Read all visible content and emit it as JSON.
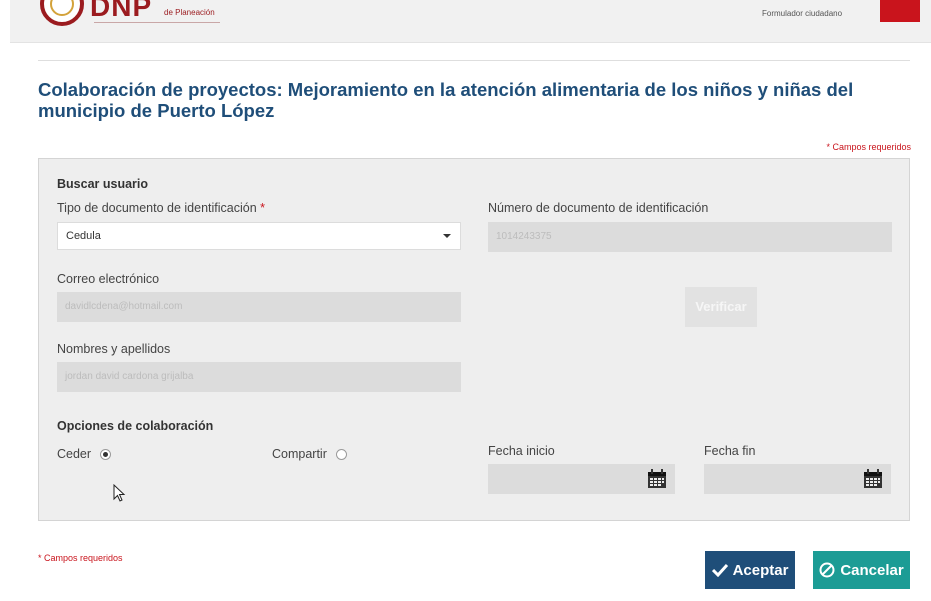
{
  "header": {
    "logo_text": "DNP",
    "logo_subtitle": "de Planeación",
    "user_link": "Formulador ciudadano"
  },
  "page": {
    "title": "Colaboración de proyectos: Mejoramiento en la atención alimentaria de los niños y niñas del municipio de Puerto López",
    "required_note_top": "* Campos requeridos",
    "required_note_bottom": "* Campos requeridos"
  },
  "search": {
    "section_title": "Buscar usuario",
    "doc_type_label": "Tipo de documento de identificación",
    "doc_type_required": "*",
    "doc_type_value": "Cedula",
    "doc_number_label": "Número de documento de identificación",
    "doc_number_value": "1014243375",
    "email_label": "Correo electrónico",
    "email_value": "davidlcdena@hotmail.com",
    "name_label": "Nombres y apellidos",
    "name_value": "jordan david cardona grijalba",
    "verify_label": "Verificar"
  },
  "collab": {
    "section_title": "Opciones de colaboración",
    "option_ceder": "Ceder",
    "option_compartir": "Compartir",
    "selected": "Ceder",
    "start_date_label": "Fecha inicio",
    "end_date_label": "Fecha fin"
  },
  "actions": {
    "accept_label": "Aceptar",
    "cancel_label": "Cancelar"
  },
  "colors": {
    "title": "#1f4e79",
    "accept": "#1f4e79",
    "cancel": "#1c9c95",
    "required": "#c9141c"
  },
  "icons": [
    "checkmark-icon",
    "cancel-icon",
    "calendar-icon",
    "dropdown-caret-icon",
    "mouse-cursor-icon"
  ]
}
